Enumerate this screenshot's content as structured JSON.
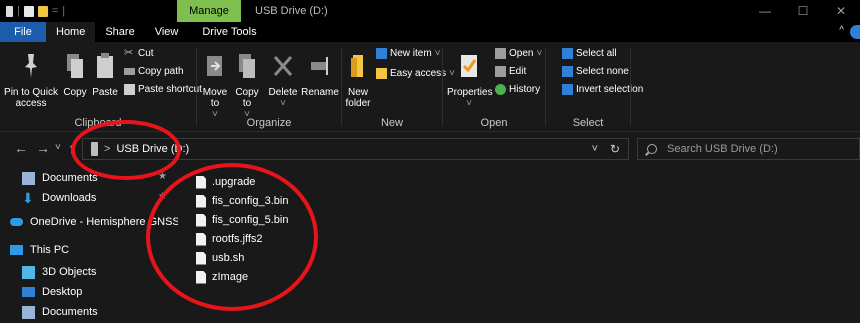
{
  "title_bar": {
    "context_tab": "Manage",
    "window_title": "USB Drive (D:)",
    "controls": [
      "—",
      "☐",
      "✕"
    ]
  },
  "tabs": [
    {
      "label": "File"
    },
    {
      "label": "Home"
    },
    {
      "label": "Share"
    },
    {
      "label": "View"
    },
    {
      "label": "Drive Tools"
    }
  ],
  "ribbon": {
    "clipboard": {
      "label": "Clipboard",
      "pin_to_quick_access": "Pin to Quick access",
      "copy": "Copy",
      "paste": "Paste",
      "cut": "Cut",
      "copy_path": "Copy path",
      "paste_shortcut": "Paste shortcut"
    },
    "organize": {
      "label": "Organize",
      "move_to": "Move to",
      "copy_to": "Copy to",
      "delete": "Delete",
      "rename": "Rename"
    },
    "new": {
      "label": "New",
      "new_folder": "New folder",
      "new_item": "New item",
      "easy_access": "Easy access"
    },
    "open": {
      "label": "Open",
      "properties": "Properties",
      "open": "Open",
      "edit": "Edit",
      "history": "History"
    },
    "select": {
      "label": "Select",
      "select_all": "Select all",
      "select_none": "Select none",
      "invert_selection": "Invert selection"
    }
  },
  "address_bar": {
    "path": "USB Drive (D:)"
  },
  "search": {
    "placeholder": "Search USB Drive (D:)"
  },
  "nav_pane": {
    "items": [
      {
        "label": "Documents",
        "icon": "documents-icon"
      },
      {
        "label": "Downloads",
        "icon": "downloads-icon"
      },
      {
        "label": "OneDrive - Hemisphere GNSS, Inc",
        "icon": "onedrive-icon"
      },
      {
        "label": "This PC",
        "icon": "this-pc-icon"
      },
      {
        "label": "3D Objects",
        "icon": "3d-objects-icon"
      },
      {
        "label": "Desktop",
        "icon": "desktop-icon"
      },
      {
        "label": "Documents",
        "icon": "documents-icon"
      }
    ]
  },
  "files": [
    {
      "name": ".upgrade"
    },
    {
      "name": "fis_config_3.bin"
    },
    {
      "name": "fis_config_5.bin"
    },
    {
      "name": "rootfs.jffs2"
    },
    {
      "name": "usb.sh"
    },
    {
      "name": "zImage"
    }
  ],
  "colors": {
    "manage_tab": "#7fbf4d",
    "file_tab": "#1c5cab",
    "annotation": "#e8141b",
    "background": "#191919"
  }
}
